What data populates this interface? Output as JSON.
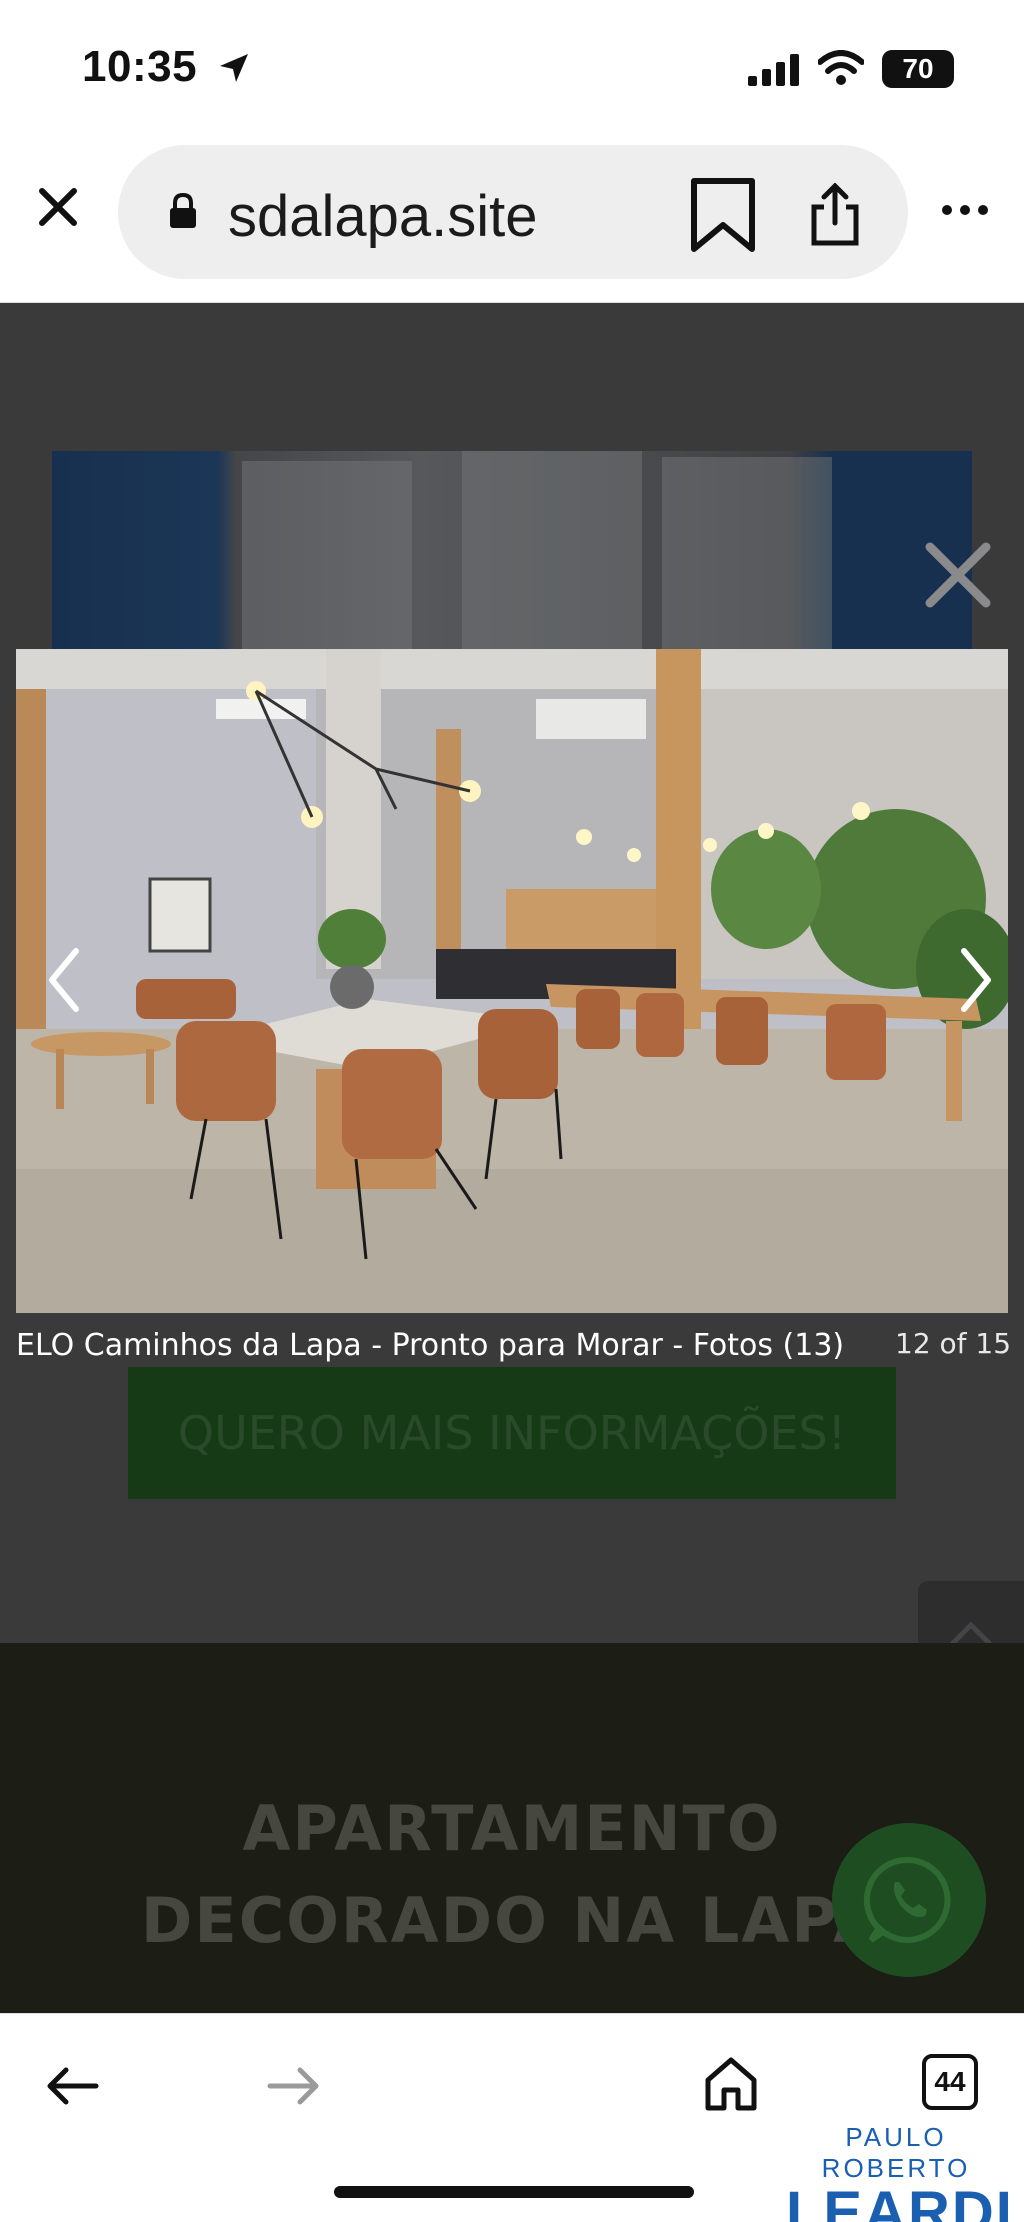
{
  "status_bar": {
    "time": "10:35",
    "battery": "70",
    "icons": [
      "location-arrow-icon",
      "signal-icon",
      "wifi-icon",
      "battery-icon"
    ]
  },
  "browser": {
    "domain": "sdalapa.site",
    "icons": [
      "close-icon",
      "lock-icon",
      "bookmark-icon",
      "share-icon",
      "more-icon"
    ]
  },
  "lightbox": {
    "caption": "ELO Caminhos da Lapa - Pronto para Morar - Fotos (13)",
    "counter": "12 of 15",
    "icons": [
      "close-icon",
      "chevron-left-icon",
      "chevron-right-icon"
    ]
  },
  "page": {
    "cta_label": "QUERO MAIS INFORMAÇÕES!",
    "banner_line1": "APARTAMENTO",
    "banner_line2": "DECORADO NA LAPA",
    "icons": [
      "chevron-up-icon",
      "whatsapp-icon"
    ]
  },
  "toolbar": {
    "tab_count": "44",
    "icons": [
      "back-arrow-icon",
      "forward-arrow-icon",
      "home-icon",
      "tabs-icon"
    ]
  },
  "watermark": {
    "top": "PAULO ROBERTO",
    "main": "LEARDI"
  },
  "colors": {
    "overlay": "#3a3a3b",
    "cta_bg": "#163a16",
    "banner_bg": "#1c1d15",
    "watermark": "#1b5fb0"
  }
}
